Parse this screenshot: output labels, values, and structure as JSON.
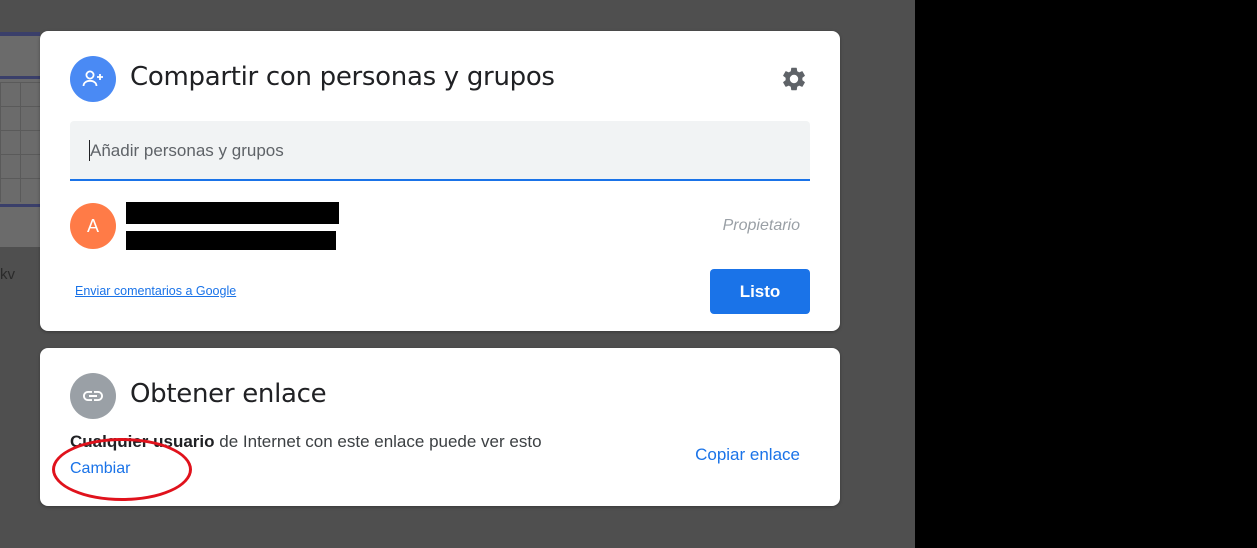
{
  "share_dialog": {
    "title": "Compartir con personas y grupos",
    "search_placeholder": "Añadir personas y grupos",
    "owner": {
      "avatar_letter": "A",
      "role": "Propietario"
    },
    "feedback_link": "Enviar comentarios a Google",
    "done_button": "Listo"
  },
  "link_dialog": {
    "title": "Obtener enlace",
    "access_who": "Cualquier usuario",
    "access_rest": " de Internet con este enlace puede ver esto",
    "change_link": "Cambiar",
    "copy_link": "Copiar enlace"
  },
  "background": {
    "partial_text": "kv"
  },
  "colors": {
    "accent": "#1a73e8",
    "avatar": "#ff7b47",
    "annotation": "#e0121c"
  },
  "icons": {
    "share": "person-add-icon",
    "settings": "gear-icon",
    "link": "link-icon"
  }
}
